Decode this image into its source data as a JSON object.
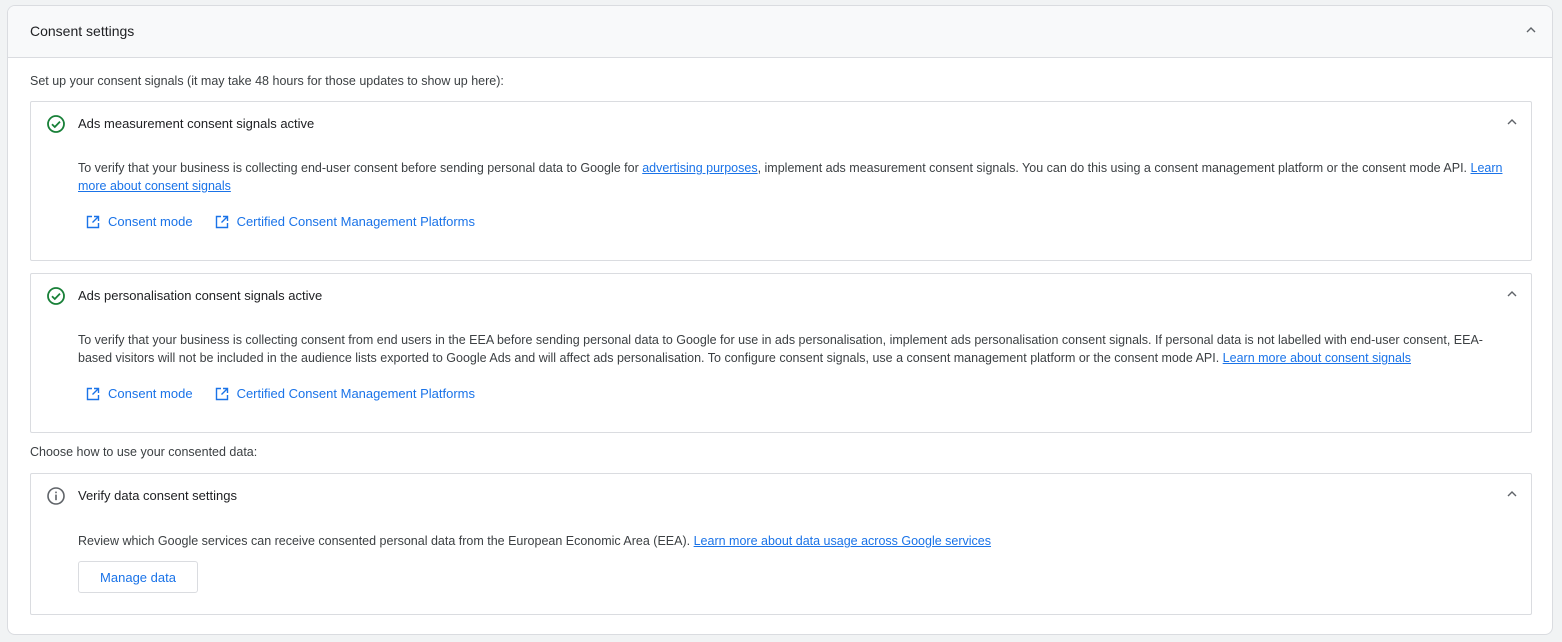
{
  "panel": {
    "title": "Consent settings",
    "intro": "Set up your consent signals (it may take 48 hours for those updates to show up here):",
    "choose_label": "Choose how to use your consented data:"
  },
  "cards": [
    {
      "title": "Ads measurement consent signals active",
      "status_icon": "check-circle-icon",
      "status_color": "#188038",
      "body_before_link": "To verify that your business is collecting end-user consent before sending personal data to Google for ",
      "inline_link": "advertising purposes",
      "body_after_link": ", implement ads measurement consent signals. You can do this using a consent management platform or the consent mode API. ",
      "learn_more": "Learn more about consent signals",
      "links": [
        "Consent mode",
        "Certified Consent Management Platforms"
      ]
    },
    {
      "title": "Ads personalisation consent signals active",
      "status_icon": "check-circle-icon",
      "status_color": "#188038",
      "body": "To verify that your business is collecting consent from end users in the EEA before sending personal data to Google for use in ads personalisation, implement ads personalisation consent signals. If personal data is not labelled with end-user consent, EEA-based visitors will not be included in the audience lists exported to Google Ads and will affect ads personalisation. To configure consent signals, use a consent management platform or the consent mode API. ",
      "learn_more": "Learn more about consent signals",
      "links": [
        "Consent mode",
        "Certified Consent Management Platforms"
      ]
    },
    {
      "title": "Verify data consent settings",
      "status_icon": "info-icon",
      "body": "Review which Google services can receive consented personal data from the European Economic Area (EEA). ",
      "learn_more": "Learn more about data usage across Google services",
      "button": "Manage data"
    }
  ],
  "colors": {
    "link": "#1a73e8",
    "success": "#188038",
    "border": "#dadce0"
  }
}
